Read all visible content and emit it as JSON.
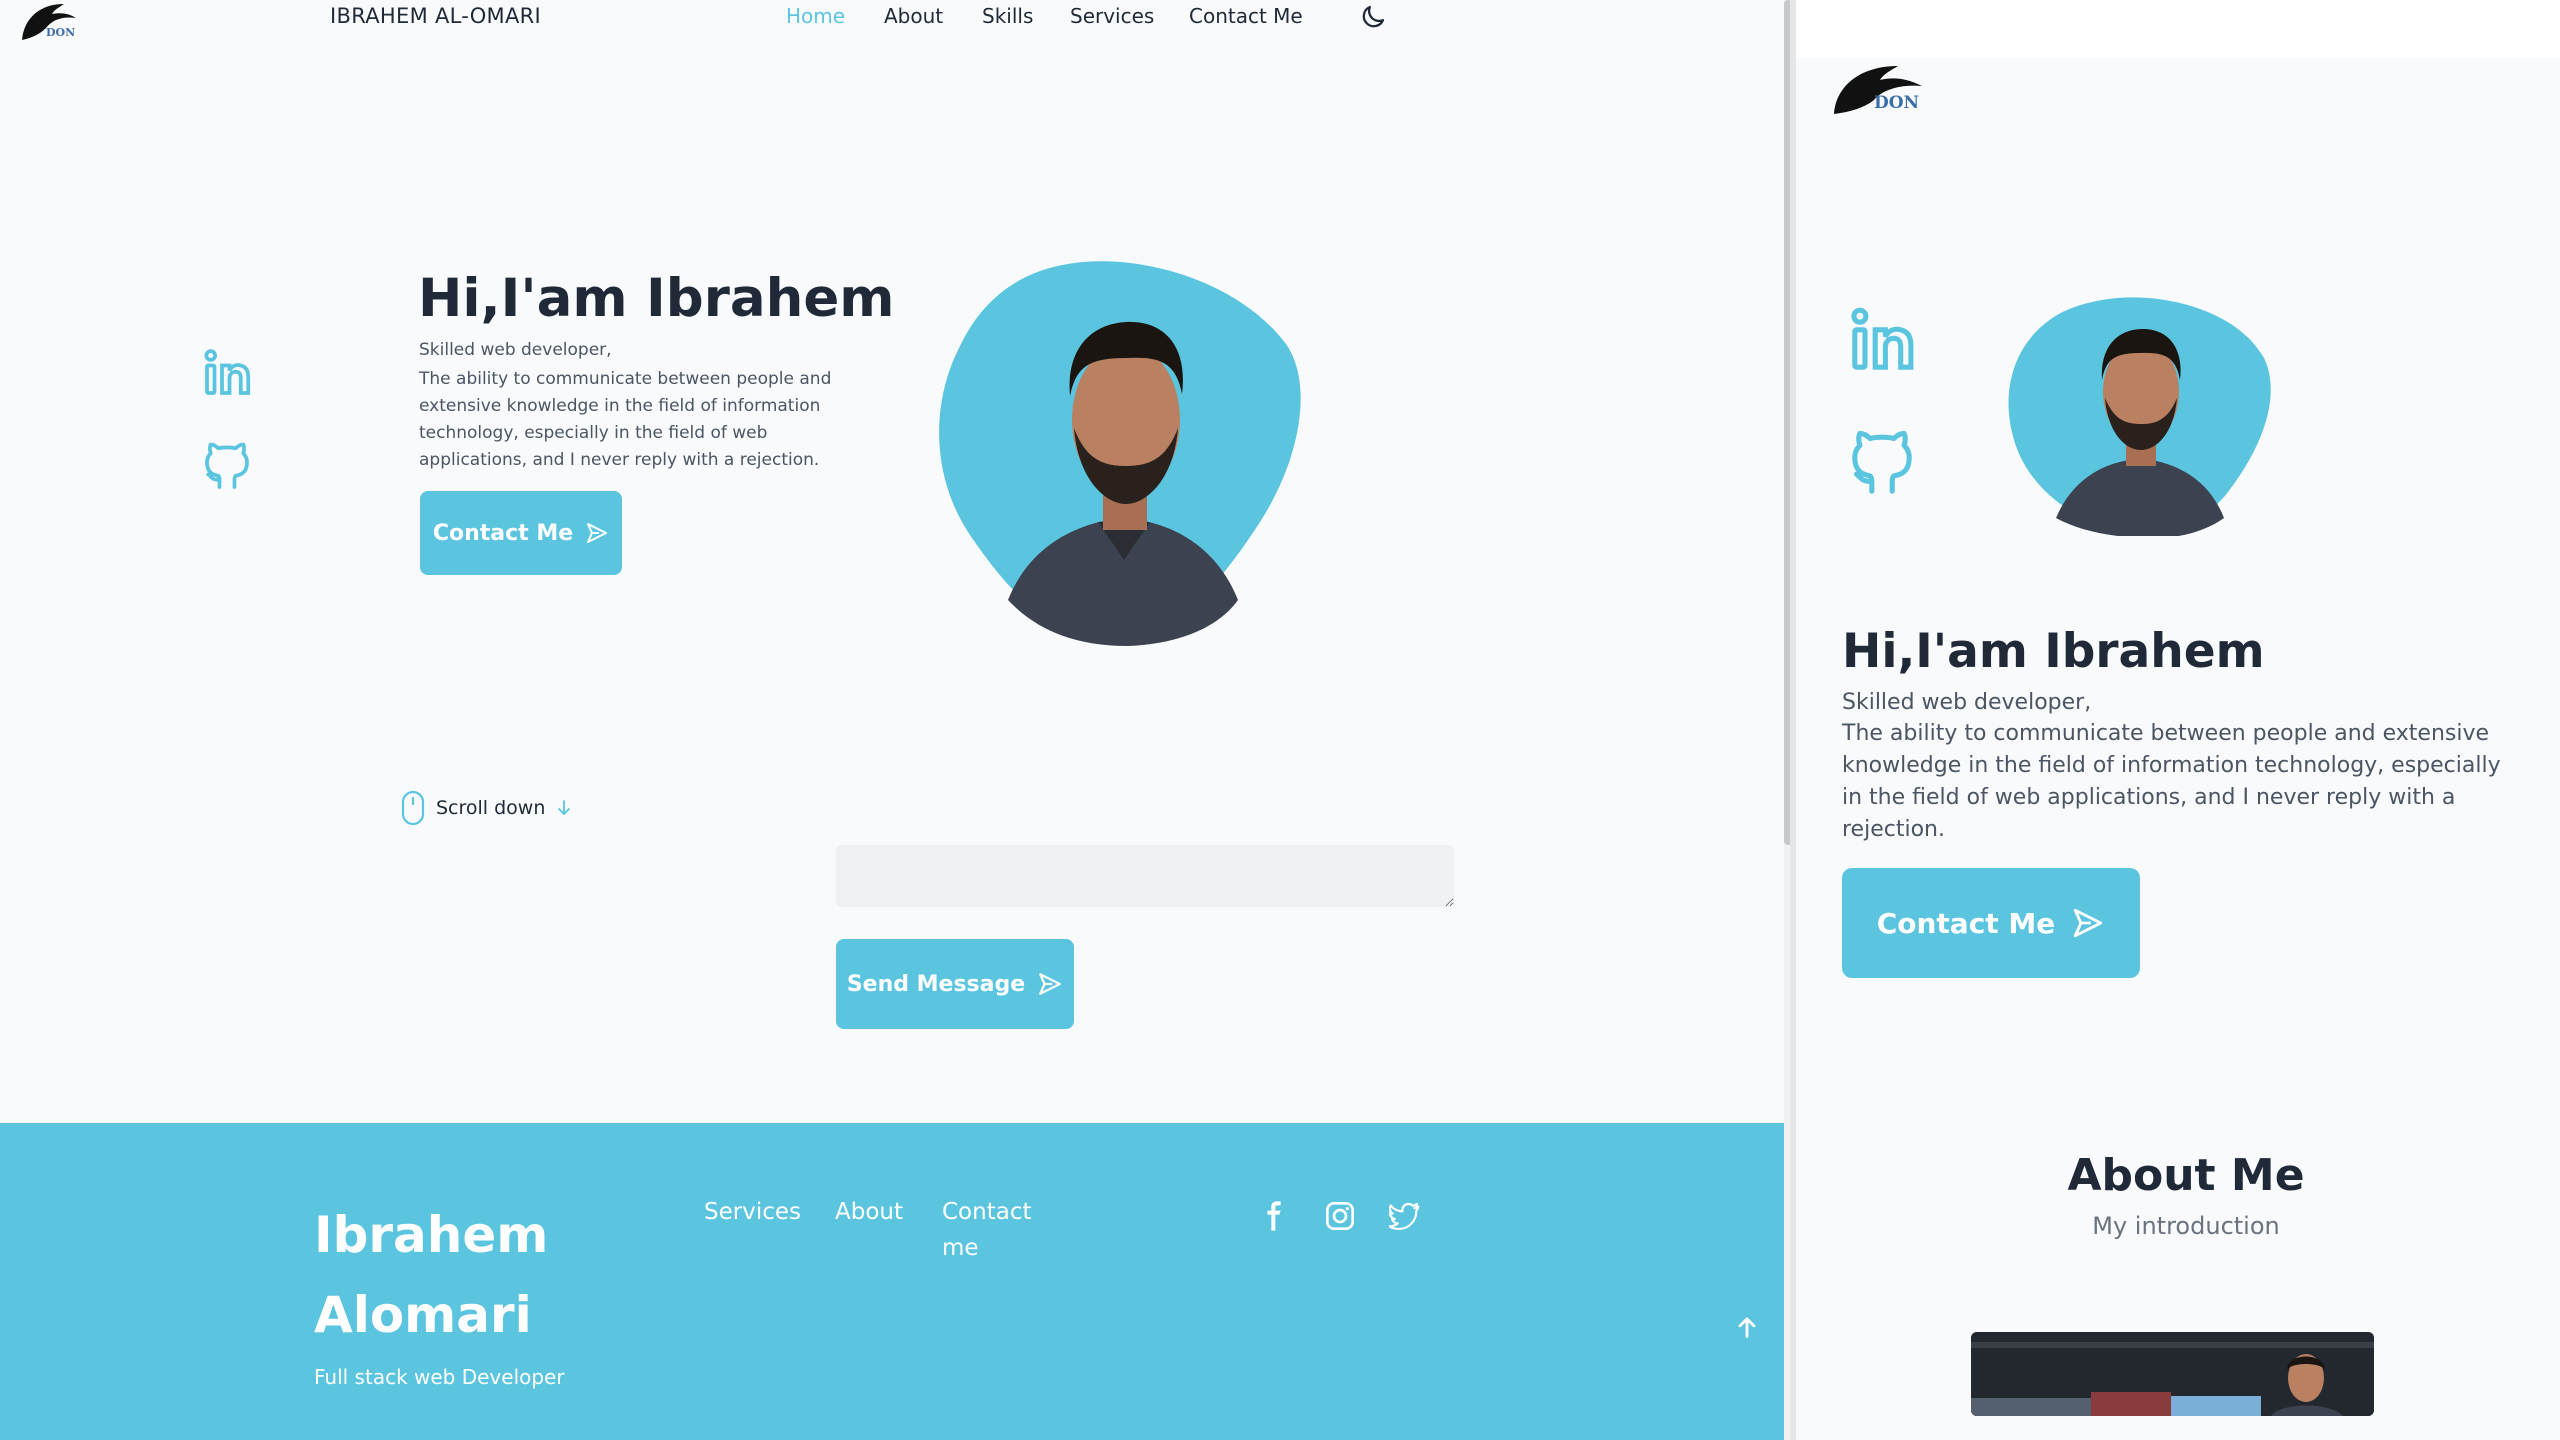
{
  "header": {
    "logo_text": "DON",
    "brand": "IBRAHEM AL-OMARI",
    "nav": [
      {
        "label": "Home",
        "active": true
      },
      {
        "label": "About",
        "active": false
      },
      {
        "label": "Skills",
        "active": false
      },
      {
        "label": "Services",
        "active": false
      },
      {
        "label": "Contact Me",
        "active": false
      }
    ],
    "theme_icon": "moon-icon"
  },
  "hero": {
    "title": "Hi,I'am Ibrahem",
    "subtitle": "Skilled web developer,",
    "description": "The ability to communicate between people and extensive knowledge in the field of information technology, especially in the field of web applications, and I never reply with a rejection.",
    "contact_button": "Contact Me",
    "social": [
      "linkedin-icon",
      "github-icon"
    ]
  },
  "scroll_down": "Scroll down",
  "contact_form": {
    "message_value": "",
    "send_button": "Send Message"
  },
  "footer": {
    "name": "Ibrahem Alomari",
    "role": "Full stack web Developer",
    "links": [
      "Services",
      "About",
      "Contact me"
    ],
    "social": [
      "facebook-icon",
      "instagram-icon",
      "twitter-icon"
    ]
  },
  "mobile": {
    "hero_title": "Hi,I'am Ibrahem",
    "hero_subtitle": "Skilled web developer,",
    "hero_description": "The ability to communicate between people and extensive knowledge in the field of information technology, especially in the field of web applications, and I never reply with a rejection.",
    "contact_button": "Contact Me",
    "about_title": "About Me",
    "about_subtitle": "My introduction"
  },
  "colors": {
    "accent": "#5bc5e0",
    "text": "#1f2937",
    "background": "#f8fafc"
  }
}
